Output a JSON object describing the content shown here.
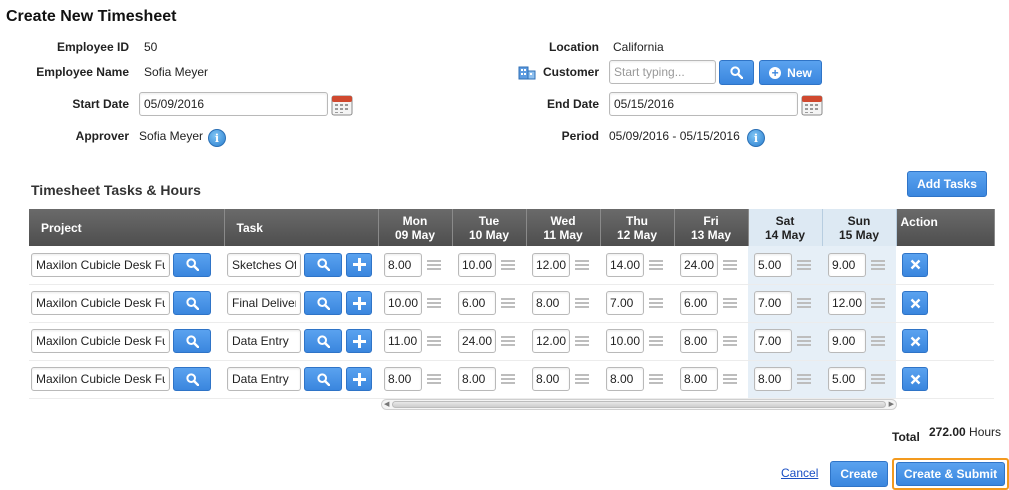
{
  "page": {
    "title": "Create New Timesheet"
  },
  "form": {
    "employee_id_label": "Employee ID",
    "employee_id": "50",
    "employee_name_label": "Employee Name",
    "employee_name": "Sofia Meyer",
    "start_date_label": "Start Date",
    "start_date": "05/09/2016",
    "approver_label": "Approver",
    "approver": "Sofia Meyer",
    "location_label": "Location",
    "location": "California",
    "customer_label": "Customer",
    "customer_placeholder": "Start typing...",
    "new_label": "New",
    "end_date_label": "End Date",
    "end_date": "05/15/2016",
    "period_label": "Period",
    "period": "05/09/2016 - 05/15/2016",
    "info_glyph": "i"
  },
  "tasks": {
    "title": "Timesheet Tasks & Hours",
    "add_tasks_label": "Add Tasks",
    "columns": {
      "project": "Project",
      "task": "Task",
      "action": "Action",
      "days": [
        {
          "day": "Mon",
          "date": "09 May"
        },
        {
          "day": "Tue",
          "date": "10 May"
        },
        {
          "day": "Wed",
          "date": "11 May"
        },
        {
          "day": "Thu",
          "date": "12 May"
        },
        {
          "day": "Fri",
          "date": "13 May"
        },
        {
          "day": "Sat",
          "date": "14 May"
        },
        {
          "day": "Sun",
          "date": "15 May"
        }
      ]
    },
    "rows": [
      {
        "project": "Maxilon Cubicle Desk Fu",
        "task": "Sketches Of T",
        "hours": [
          "8.00",
          "10.00",
          "12.00",
          "14.00",
          "24.00",
          "5.00",
          "9.00"
        ]
      },
      {
        "project": "Maxilon Cubicle Desk Fu",
        "task": "Final Deliver",
        "hours": [
          "10.00",
          "6.00",
          "8.00",
          "7.00",
          "6.00",
          "7.00",
          "12.00"
        ]
      },
      {
        "project": "Maxilon Cubicle Desk Fu",
        "task": "Data Entry",
        "hours": [
          "11.00",
          "24.00",
          "12.00",
          "10.00",
          "8.00",
          "7.00",
          "9.00"
        ]
      },
      {
        "project": "Maxilon Cubicle Desk Fu",
        "task": "Data Entry",
        "hours": [
          "8.00",
          "8.00",
          "8.00",
          "8.00",
          "8.00",
          "8.00",
          "5.00"
        ]
      }
    ]
  },
  "totals": {
    "label": "Total",
    "value": "272.00",
    "unit": "Hours"
  },
  "actions": {
    "cancel": "Cancel",
    "create": "Create",
    "create_submit": "Create & Submit"
  },
  "colors": {
    "accent": "#3a86de",
    "header": "#555555",
    "weekend": "#e6eff7",
    "focus_ring": "#f39a1e"
  }
}
